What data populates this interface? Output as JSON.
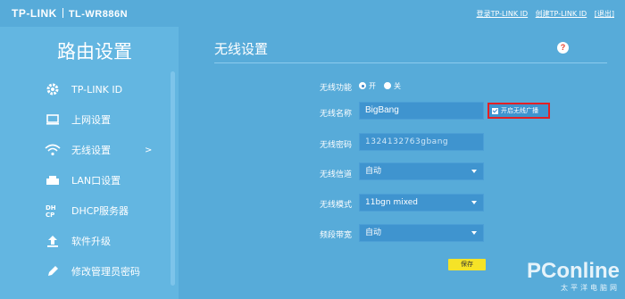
{
  "header": {
    "logo": "TP-LINK",
    "model": "TL-WR886N",
    "links": [
      "登录TP-LINK ID",
      "创建TP-LINK ID",
      "[退出]"
    ]
  },
  "sidebar": {
    "title": "路由设置",
    "items": [
      {
        "label": "TP-LINK ID",
        "icon": "gear-icon"
      },
      {
        "label": "上网设置",
        "icon": "monitor-icon"
      },
      {
        "label": "无线设置",
        "icon": "wifi-icon",
        "arrow": ">"
      },
      {
        "label": "LAN口设置",
        "icon": "lan-port-icon"
      },
      {
        "label": "DHCP服务器",
        "icon": "dhcp-icon"
      },
      {
        "label": "软件升级",
        "icon": "upload-arrow-icon"
      },
      {
        "label": "修改管理员密码",
        "icon": "pencil-icon"
      }
    ]
  },
  "main": {
    "title": "无线设置",
    "help": "?",
    "wireless_function": {
      "label": "无线功能",
      "on": "开",
      "off": "关",
      "selected": "开"
    },
    "ssid": {
      "label": "无线名称",
      "value": "BigBang"
    },
    "broadcast": {
      "label": "开启无线广播",
      "checked": true
    },
    "password": {
      "label": "无线密码",
      "value": "1324132763gbang"
    },
    "channel": {
      "label": "无线信道",
      "value": "自动"
    },
    "mode": {
      "label": "无线模式",
      "value": "11bgn mixed"
    },
    "bandwidth": {
      "label": "频段带宽",
      "value": "自动"
    },
    "save_label": "保存"
  },
  "watermark": {
    "main": "PConline",
    "sub": "太平洋电脑网"
  },
  "colors": {
    "background": "#57abd9",
    "sidebar": "#63b6e1",
    "field": "#3f94cf",
    "save": "#f5e327",
    "highlight": "#e32025"
  }
}
